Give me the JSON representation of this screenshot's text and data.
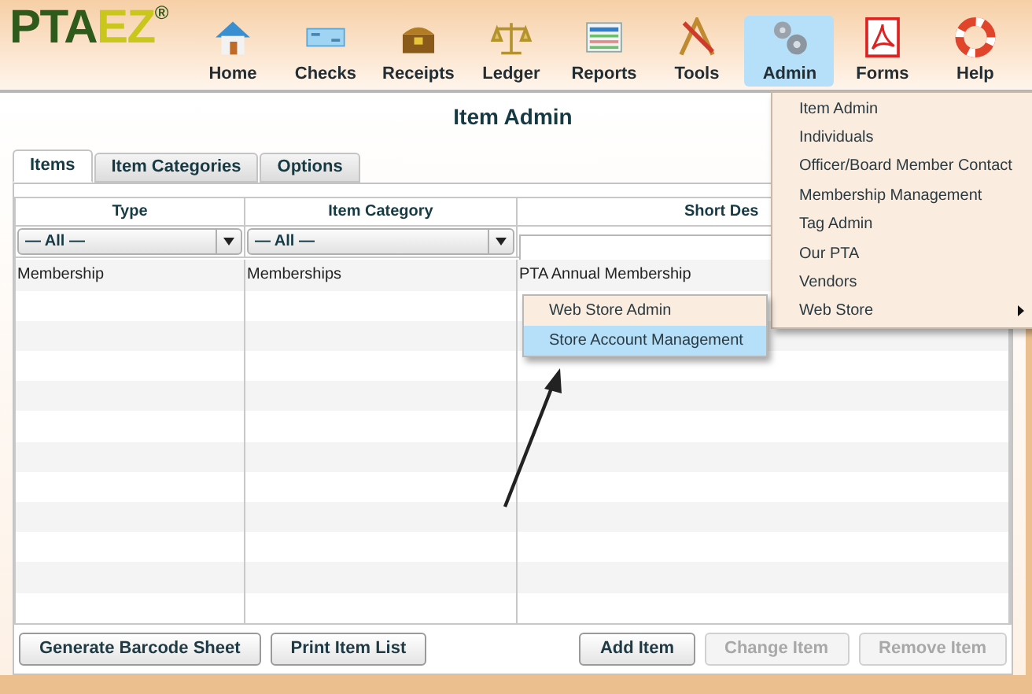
{
  "logo": {
    "main": "PTA",
    "accent": "EZ",
    "mark": "®"
  },
  "nav": [
    {
      "label": "Home",
      "selected": false
    },
    {
      "label": "Checks",
      "selected": false
    },
    {
      "label": "Receipts",
      "selected": false
    },
    {
      "label": "Ledger",
      "selected": false
    },
    {
      "label": "Reports",
      "selected": false
    },
    {
      "label": "Tools",
      "selected": false
    },
    {
      "label": "Admin",
      "selected": true
    },
    {
      "label": "Forms",
      "selected": false
    },
    {
      "label": "Help",
      "selected": false
    }
  ],
  "page_title": "Item Admin",
  "tabs": [
    {
      "label": "Items",
      "selected": true
    },
    {
      "label": "Item Categories",
      "selected": false
    },
    {
      "label": "Options",
      "selected": false
    }
  ],
  "table": {
    "columns": [
      {
        "label": "Type",
        "filter": "— All —"
      },
      {
        "label": "Item Category",
        "filter": "— All —"
      },
      {
        "label": "Short Des"
      }
    ],
    "rows": [
      [
        "Membership",
        "Memberships",
        "PTA Annual Membership"
      ]
    ]
  },
  "admin_menu": [
    {
      "label": "Item Admin",
      "submenu": false
    },
    {
      "label": "Individuals",
      "submenu": false
    },
    {
      "label": "Officer/Board Member Contact",
      "submenu": false
    },
    {
      "label": "Membership Management",
      "submenu": false
    },
    {
      "label": "Tag Admin",
      "submenu": false
    },
    {
      "label": "Our PTA",
      "submenu": false
    },
    {
      "label": "Vendors",
      "submenu": false
    },
    {
      "label": "Web Store",
      "submenu": true
    }
  ],
  "submenu": [
    {
      "label": "Web Store Admin",
      "selected": false
    },
    {
      "label": "Store Account Management",
      "selected": true
    }
  ],
  "buttons_left": [
    {
      "label": "Generate Barcode Sheet",
      "disabled": false
    },
    {
      "label": "Print Item List",
      "disabled": false
    }
  ],
  "buttons_right": [
    {
      "label": "Add Item",
      "disabled": false
    },
    {
      "label": "Change Item",
      "disabled": true
    },
    {
      "label": "Remove Item",
      "disabled": true
    }
  ]
}
